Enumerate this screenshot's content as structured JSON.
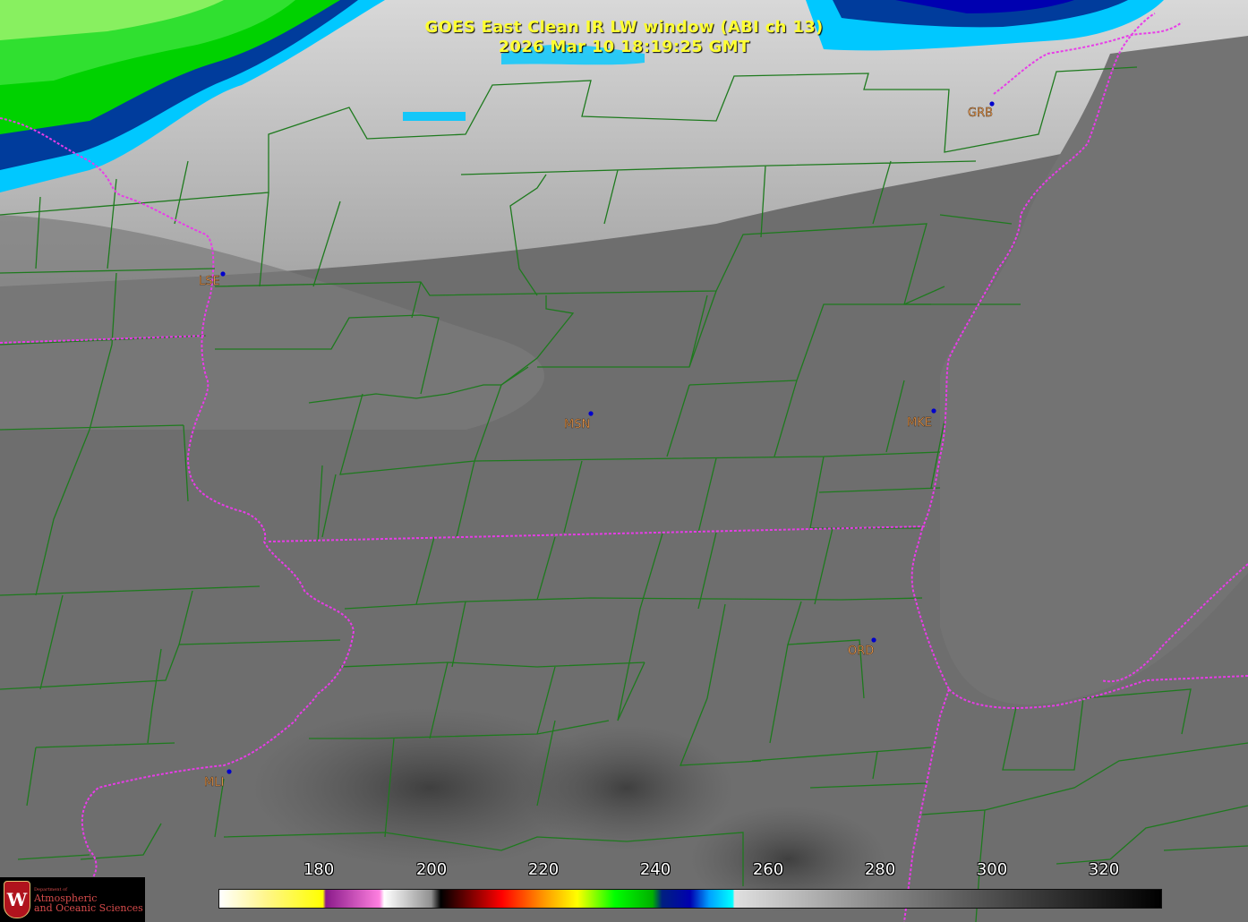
{
  "title": {
    "line1": "GOES East Clean IR LW window (ABI ch 13)",
    "line2": "2026 Mar 10  18:19:25 GMT"
  },
  "stations": [
    {
      "code": "GRB"
    },
    {
      "code": "LSE"
    },
    {
      "code": "MSN"
    },
    {
      "code": "MKE"
    },
    {
      "code": "ORD"
    },
    {
      "code": "MLI"
    }
  ],
  "colorbar": {
    "ticks": [
      "180",
      "200",
      "220",
      "240",
      "260",
      "280",
      "300",
      "320"
    ]
  },
  "logo": {
    "dept": "Department of",
    "line1": "Atmospheric",
    "line2": "and Oceanic Sciences"
  },
  "colors": {
    "county_lines": "#1e7a1e",
    "state_lines": "#e83ce8",
    "station_dot": "#0000cc",
    "station_label": "#f5a050",
    "title": "#ffff33"
  }
}
